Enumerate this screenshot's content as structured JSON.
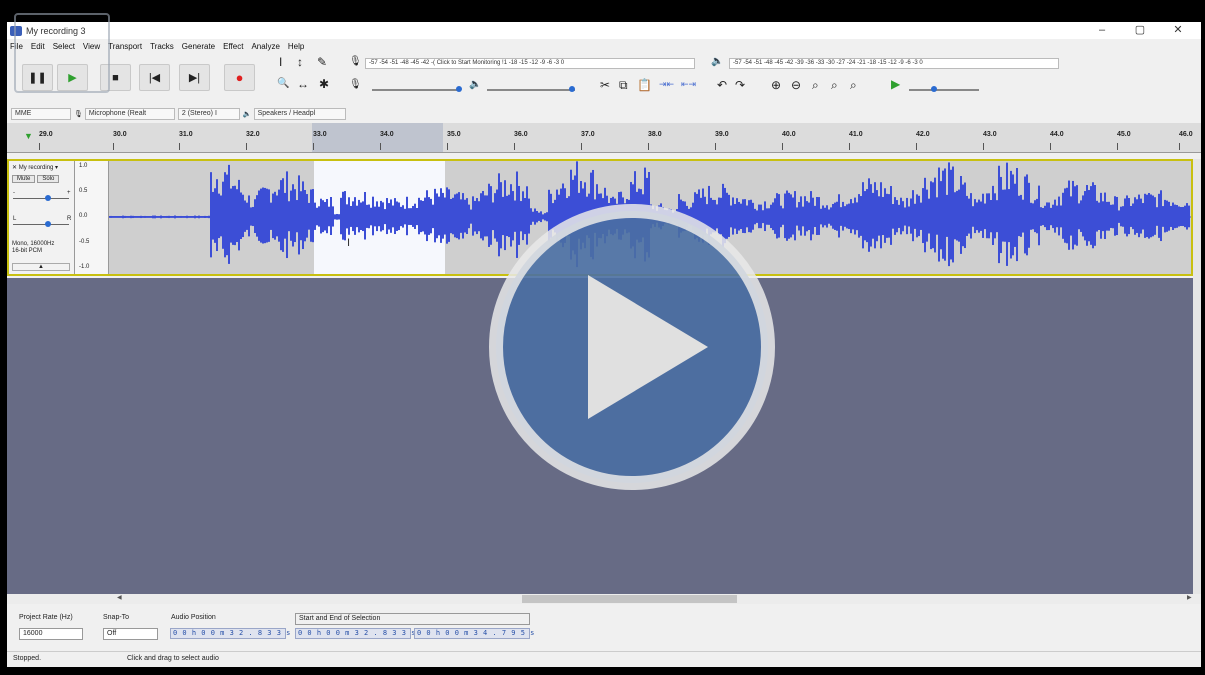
{
  "window": {
    "title": "My recording 3",
    "controls": [
      "–",
      "▢",
      "✕"
    ]
  },
  "menu": [
    "File",
    "Edit",
    "Select",
    "View",
    "Transport",
    "Tracks",
    "Generate",
    "Effect",
    "Analyze",
    "Help"
  ],
  "transport": {
    "pause": "❚❚",
    "play": "▶",
    "stop": "■",
    "skip_start": "|◀",
    "skip_end": "▶|",
    "record": "●"
  },
  "tools": {
    "select": "I",
    "envelope": "↕",
    "draw": "✎",
    "zoom": "🔍",
    "timeshift": "↔",
    "multi": "✱"
  },
  "meters": {
    "record_scale": "-57 -54 -51 -48 -45 -42 -( Click to Start Monitoring !1 -18 -15 -12 -9 -6 -3 0",
    "play_scale": "-57 -54 -51 -48 -45 -42 -39 -36 -33 -30 -27 -24 -21 -18 -15 -12 -9 -6 -3 0"
  },
  "edit_icons": [
    "✂",
    "⧉",
    "📋",
    "⇥⇤",
    "⇤⇥",
    "↶",
    "↷",
    "⊕",
    "⊖",
    "⌕",
    "⌕",
    "⌕"
  ],
  "devices": {
    "host": "MME",
    "mic_icon": "microphone-icon",
    "input": "Microphone (Realt",
    "channels": "2 (Stereo) I",
    "speaker_icon": "speaker-icon",
    "output": "Speakers / Headpl"
  },
  "ruler": {
    "ticks": [
      "29.0",
      "30.0",
      "31.0",
      "32.0",
      "33.0",
      "34.0",
      "35.0",
      "36.0",
      "37.0",
      "38.0",
      "39.0",
      "40.0",
      "41.0",
      "42.0",
      "43.0",
      "44.0",
      "45.0",
      "46.0"
    ]
  },
  "track": {
    "name": "My recording",
    "mute": "Mute",
    "solo": "Solo",
    "gain_minus": "-",
    "gain_plus": "+",
    "pan_l": "L",
    "pan_r": "R",
    "info": [
      "Mono, 16000Hz",
      "16-bit PCM"
    ],
    "scale": [
      "1.0",
      "0.5",
      "0.0",
      "-0.5",
      "-1.0"
    ],
    "wave_color": "#3c4ed6"
  },
  "selection_bar": {
    "project_rate_label": "Project Rate (Hz)",
    "project_rate": "16000",
    "snap_label": "Snap-To",
    "snap_value": "Off",
    "audio_position_label": "Audio Position",
    "audio_position": "0 0 h 0 0 m 3 2 . 8 3 3 s",
    "selection_label": "Start and End of Selection",
    "sel_start": "0 0 h 0 0 m 3 2 . 8 3 3 s",
    "sel_end": "0 0 h 0 0 m 3 4 . 7 9 5 s"
  },
  "status": {
    "state": "Stopped.",
    "hint": "Click and drag to select audio"
  },
  "overlay": {
    "play_icon": "play-overlay-icon"
  }
}
